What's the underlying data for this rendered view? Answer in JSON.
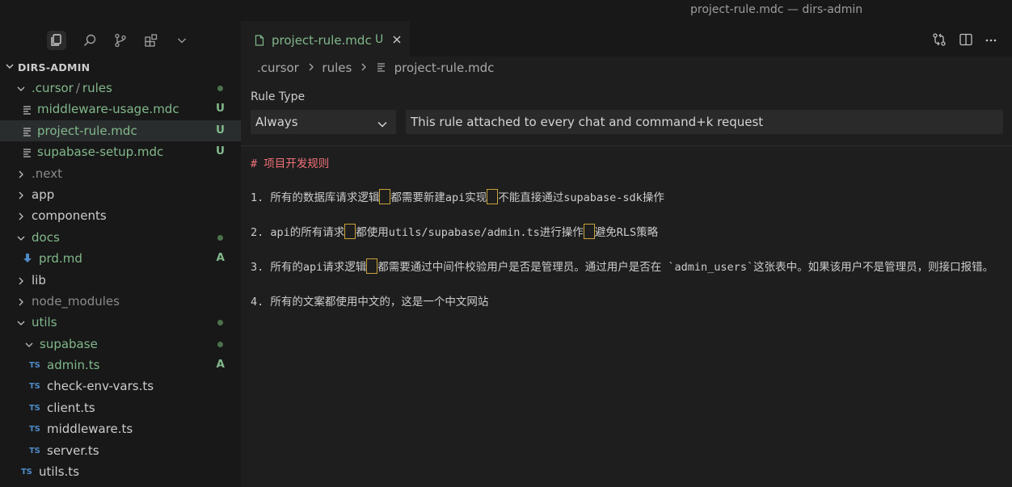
{
  "window": {
    "title": "project-rule.mdc — dirs-admin"
  },
  "activity_bar": {
    "items": [
      {
        "name": "explorer",
        "icon": "files-icon",
        "active": true
      },
      {
        "name": "search",
        "icon": "search-icon"
      },
      {
        "name": "source-control",
        "icon": "source-control-icon"
      },
      {
        "name": "extensions",
        "icon": "extensions-icon"
      },
      {
        "name": "more",
        "icon": "chevron-down-icon"
      }
    ]
  },
  "explorer": {
    "root_label": "DIRS-ADMIN",
    "items": [
      {
        "label": ".cursor",
        "sep": "/",
        "label2": "rules",
        "type": "folder",
        "open": true,
        "depth": 1,
        "color": "green",
        "status": "dot"
      },
      {
        "label": "middleware-usage.mdc",
        "type": "file",
        "icon": "lines",
        "depth": 2,
        "color": "green",
        "status": "U"
      },
      {
        "label": "project-rule.mdc",
        "type": "file",
        "icon": "lines",
        "depth": 2,
        "color": "green",
        "status": "U",
        "selected": true
      },
      {
        "label": "supabase-setup.mdc",
        "type": "file",
        "icon": "lines",
        "depth": 2,
        "color": "green",
        "status": "U"
      },
      {
        "label": ".next",
        "type": "folder",
        "open": false,
        "depth": 1,
        "color": "dim"
      },
      {
        "label": "app",
        "type": "folder",
        "open": false,
        "depth": 1
      },
      {
        "label": "components",
        "type": "folder",
        "open": false,
        "depth": 1
      },
      {
        "label": "docs",
        "type": "folder",
        "open": true,
        "depth": 1,
        "color": "green",
        "status": "dot"
      },
      {
        "label": "prd.md",
        "type": "file",
        "icon": "md",
        "depth": 2,
        "color": "green",
        "status": "A"
      },
      {
        "label": "lib",
        "type": "folder",
        "open": false,
        "depth": 1
      },
      {
        "label": "node_modules",
        "type": "folder",
        "open": false,
        "depth": 1,
        "color": "dim"
      },
      {
        "label": "utils",
        "type": "folder",
        "open": true,
        "depth": 1,
        "color": "green",
        "status": "dot"
      },
      {
        "label": "supabase",
        "type": "folder",
        "open": true,
        "depth": 2,
        "color": "green",
        "status": "dot"
      },
      {
        "label": "admin.ts",
        "type": "file",
        "icon": "ts",
        "depth": 3,
        "color": "green",
        "status": "A"
      },
      {
        "label": "check-env-vars.ts",
        "type": "file",
        "icon": "ts",
        "depth": 3
      },
      {
        "label": "client.ts",
        "type": "file",
        "icon": "ts",
        "depth": 3
      },
      {
        "label": "middleware.ts",
        "type": "file",
        "icon": "ts",
        "depth": 3
      },
      {
        "label": "server.ts",
        "type": "file",
        "icon": "ts",
        "depth": 3
      },
      {
        "label": "utils.ts",
        "type": "file",
        "icon": "ts",
        "depth": 2
      }
    ]
  },
  "editor": {
    "tab": {
      "label": "project-rule.mdc",
      "status": "U"
    },
    "breadcrumb": [
      ".cursor",
      "rules",
      "project-rule.mdc"
    ],
    "rule_type_label": "Rule Type",
    "rule_type_value": "Always",
    "rule_description": "This rule attached to every chat and command+k request",
    "heading": "# 项目开发规则",
    "paragraphs": [
      {
        "segments": [
          "1. 所有的数据库请求逻辑",
          "都需要新建api实现",
          "不能直接通过supabase-sdk操作"
        ]
      },
      {
        "segments": [
          "2. api的所有请求",
          "都使用utils/supabase/admin.ts进行操作",
          "避免RLS策略"
        ]
      },
      {
        "segments": [
          "3. 所有的api请求逻辑",
          "都需要通过中间件校验用户是否是管理员。通过用户是否在 `admin_users`这张表中。如果该用户不是管理员，则接口报错。"
        ]
      },
      {
        "segments": [
          "4. 所有的文案都使用中文的，这是一个中文网站"
        ]
      }
    ]
  },
  "colors": {
    "git_added": "#81b88b",
    "heading": "#f07178",
    "highlight_border": "#c8a23a",
    "ts_icon": "#4d8ac7"
  }
}
